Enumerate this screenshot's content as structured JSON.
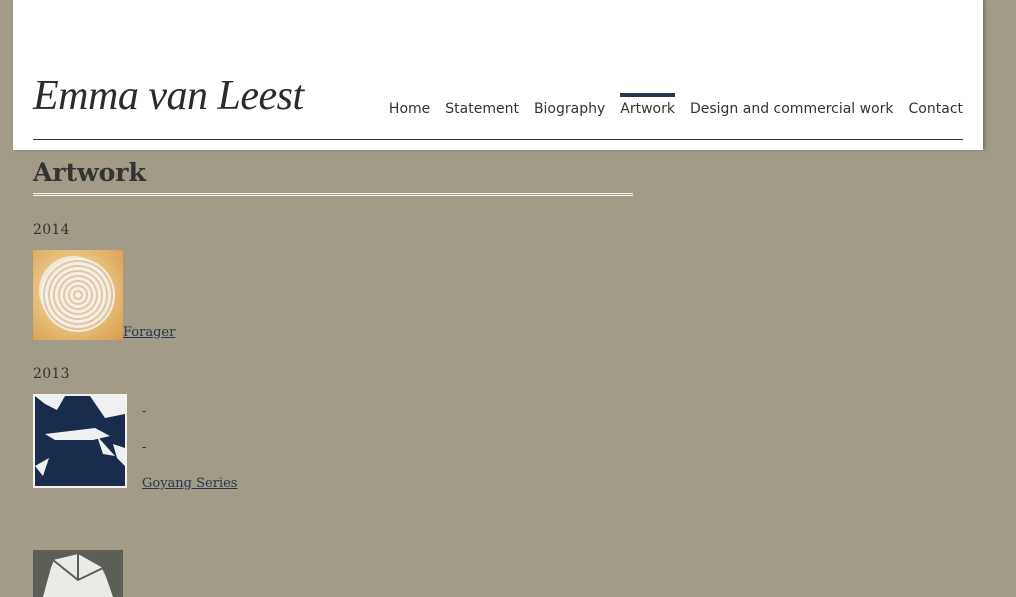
{
  "site": {
    "title": "Emma van Leest"
  },
  "nav": {
    "items": [
      {
        "label": "Home"
      },
      {
        "label": "Statement"
      },
      {
        "label": "Biography"
      },
      {
        "label": "Artwork",
        "active": true
      },
      {
        "label": "Design and commercial work"
      },
      {
        "label": "Contact"
      }
    ]
  },
  "main": {
    "title": "Artwork",
    "sections": [
      {
        "year": "2014",
        "works": [
          {
            "title": "Forager"
          }
        ]
      },
      {
        "year": "2013",
        "works": [
          {
            "line1": "-",
            "line2": "-",
            "title": "Goyang Series"
          }
        ]
      }
    ]
  },
  "colors": {
    "background": "#a29b88",
    "header": "#ffffff",
    "accent": "#26374f",
    "text": "#333333"
  }
}
